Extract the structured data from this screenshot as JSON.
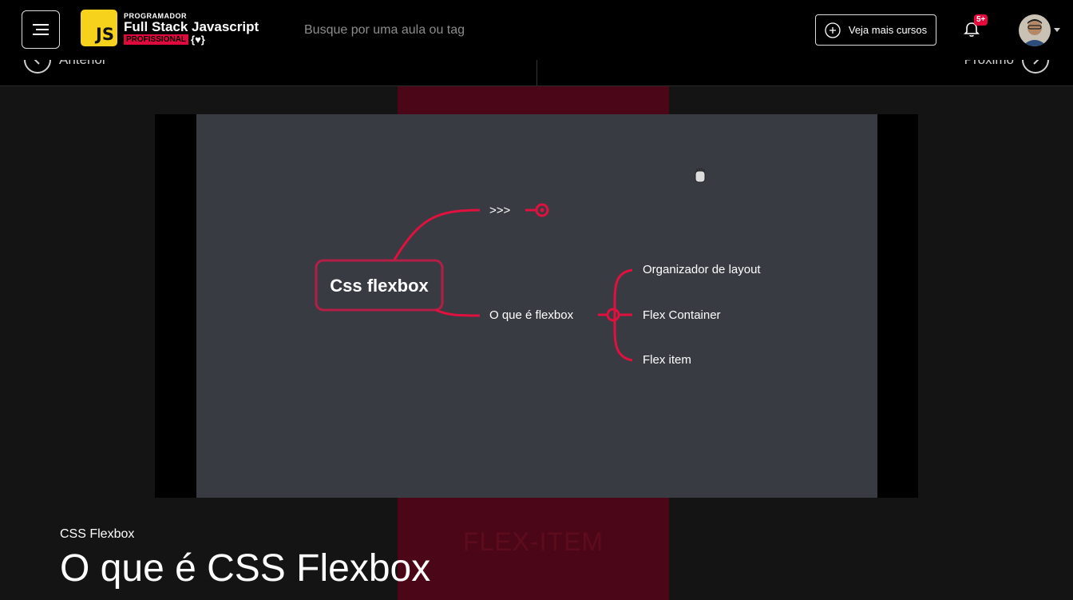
{
  "header": {
    "logo": {
      "badge": "JS",
      "top": "PROGRAMADOR",
      "main": "Full Stack Javascript",
      "pro": "PROFISSIONAL",
      "brace": "{♥}"
    },
    "search_placeholder": "Busque por uma aula ou tag",
    "courses_button": "Veja mais cursos",
    "notification_count": "5+"
  },
  "lesson_nav": {
    "prev_label": "Anterior",
    "next_label": "Próximo"
  },
  "player": {
    "background_text": "FLEX-ITEM",
    "mindmap": {
      "root": "Css flexbox",
      "branch_top": ">>>",
      "branch_bottom": "O que é flexbox",
      "children": [
        "Organizador de layout",
        "Flex Container",
        "Flex item"
      ]
    },
    "accent_color": "#e0103f"
  },
  "lesson": {
    "category": "CSS Flexbox",
    "title": "O que é CSS Flexbox"
  }
}
